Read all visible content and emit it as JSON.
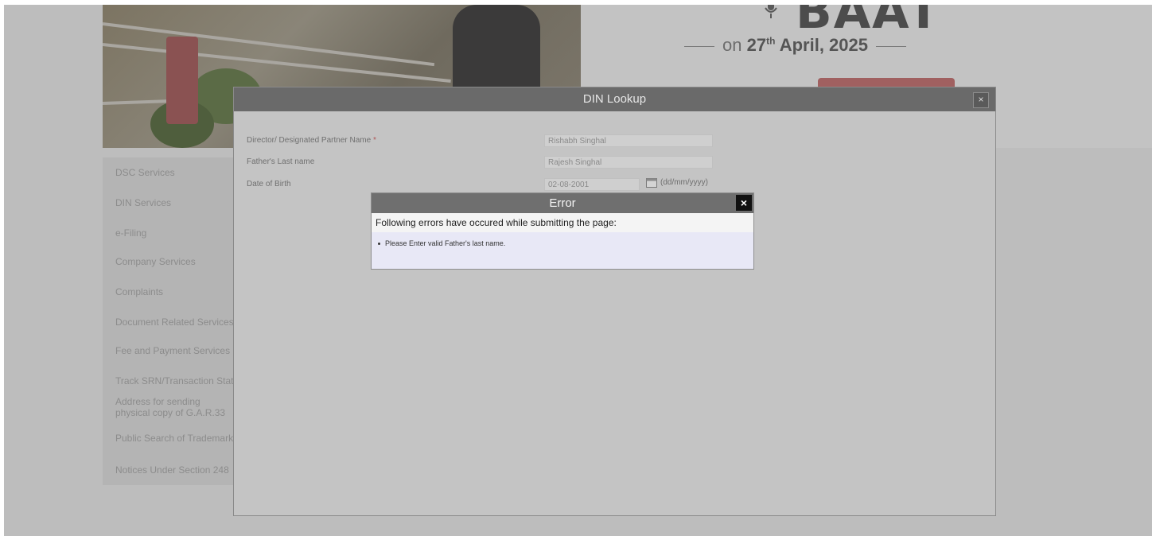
{
  "banner": {
    "headline": "BAAT",
    "date_prefix": "on",
    "date_day": "27",
    "date_suffix": "th",
    "date_rest": "April, 2025"
  },
  "sidenav": {
    "items": [
      "DSC Services",
      "DIN Services",
      "e-Filing",
      "Company Services",
      "Complaints",
      "Document Related Services",
      "Fee and Payment Services",
      "Track SRN/Transaction Status",
      "Address for sending physical copy of G.A.R.33",
      "Public Search of Trademark",
      "Notices Under Section 248"
    ]
  },
  "din_lookup": {
    "title": "DIN Lookup",
    "close_label": "×",
    "fields": {
      "director_label": "Director/ Designated Partner Name",
      "required_mark": "*",
      "director_value": "Rishabh Singhal",
      "father_label": "Father's Last name",
      "father_value": "Rajesh Singhal",
      "dob_label": "Date of Birth",
      "dob_value": "02-08-2001",
      "dob_format": "(dd/mm/yyyy)"
    }
  },
  "error_dialog": {
    "title": "Error",
    "close_label": "×",
    "intro": "Following errors have occured while submitting the page:",
    "errors": [
      "Please Enter valid Father's last name."
    ]
  },
  "colors": {
    "overlay": "#bdbdbd",
    "modal_header": "#6a6a6a",
    "error_body": "#e8e8f6"
  }
}
